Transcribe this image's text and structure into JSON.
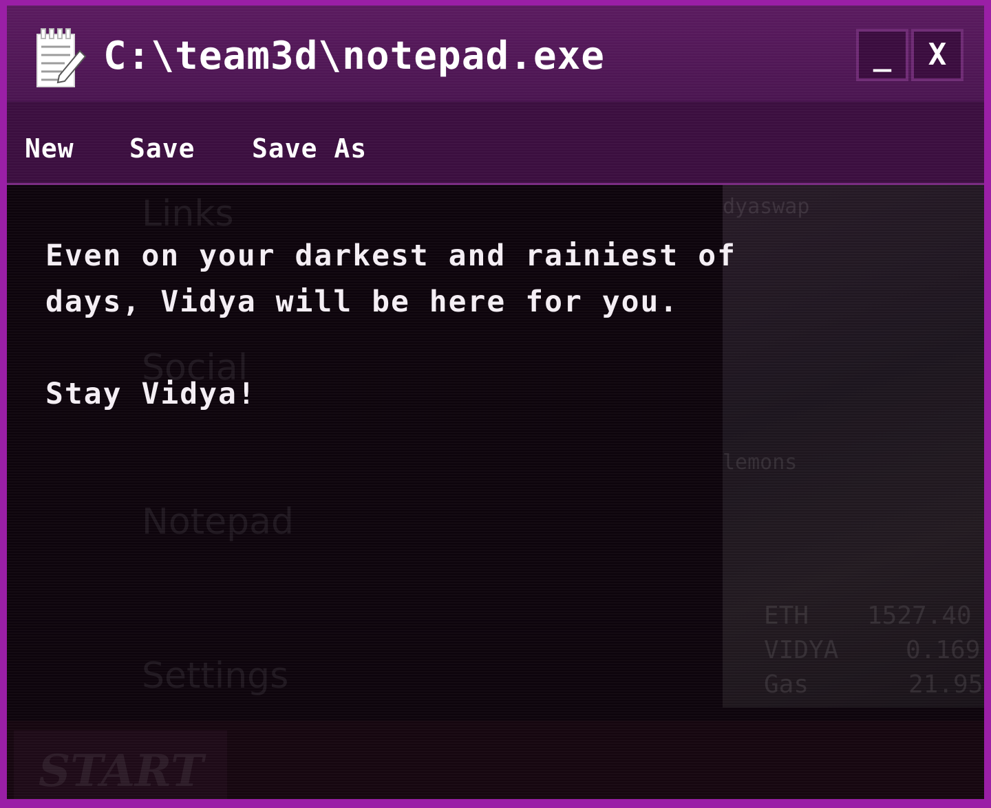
{
  "window": {
    "title": "C:\\team3d\\notepad.exe",
    "icon": "notepad-icon",
    "minimize_label": "_",
    "close_label": "X"
  },
  "menu": {
    "new_label": "New",
    "save_label": "Save",
    "save_as_label": "Save As"
  },
  "document": {
    "text": "Even on your darkest and rainiest of\ndays, Vidya will be here for you.\n\nStay Vidya!"
  },
  "background_desktop": {
    "icons": [
      {
        "label": "Links",
        "icon": "link-icon"
      },
      {
        "label": "Social",
        "icon": "people-icon"
      },
      {
        "label": "Notepad",
        "icon": "notepad-icon"
      },
      {
        "label": "Settings",
        "icon": "gear-icon"
      }
    ],
    "side_labels": [
      "dyaswap",
      "lemons"
    ],
    "prices": [
      {
        "name": "ETH",
        "value": "1527.40"
      },
      {
        "name": "VIDYA",
        "value": "0.169"
      },
      {
        "name": "Gas",
        "value": "21.95"
      }
    ],
    "start_label": "START"
  },
  "colors": {
    "border": "#9a1fa6",
    "titlebar": "#5a1a5f",
    "menubar": "#3b0e3f",
    "content_bg": "#0d040c",
    "text": "#f4eef4"
  }
}
